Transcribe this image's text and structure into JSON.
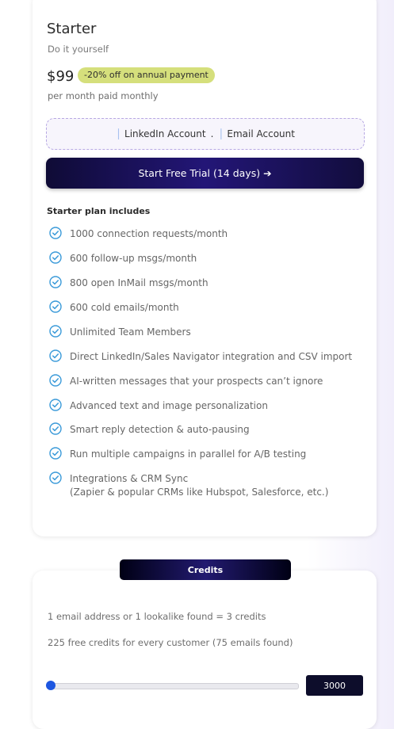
{
  "plan": {
    "name": "Starter",
    "subtitle": "Do it yourself",
    "price": "$99",
    "discount_badge": "-20% off on annual payment",
    "price_note": "per month paid monthly",
    "accounts": {
      "linkedin": "LinkedIn Account",
      "separator": ".",
      "email": "Email Account"
    },
    "cta_label": "Start Free Trial (14 days) ➔",
    "includes_title": "Starter plan includes",
    "features": [
      [
        "1000 connection requests/month"
      ],
      [
        "600 follow-up msgs/month"
      ],
      [
        "800 open InMail msgs/month"
      ],
      [
        "600 cold emails/month"
      ],
      [
        "Unlimited Team Members"
      ],
      [
        "Direct LinkedIn/Sales Navigator integration and CSV import"
      ],
      [
        "AI-written messages that your prospects can’t ignore"
      ],
      [
        "Advanced text and image personalization"
      ],
      [
        "Smart reply detection & auto-pausing"
      ],
      [
        "Run multiple campaigns in parallel for A/B testing"
      ],
      [
        "Integrations & CRM Sync",
        "(Zapier & popular CRMs like Hubspot, Salesforce, etc.)"
      ]
    ]
  },
  "credits": {
    "tab_label": "Credits",
    "line1": "1 email address or 1 lookalike found = 3 credits",
    "line2": "225 free credits for every customer (75 emails found)",
    "slider_fraction": 0.0,
    "value": "3000"
  },
  "colors": {
    "check": "#3a9ad9",
    "cta": "#1a1260",
    "badge": "#d5df7c"
  }
}
